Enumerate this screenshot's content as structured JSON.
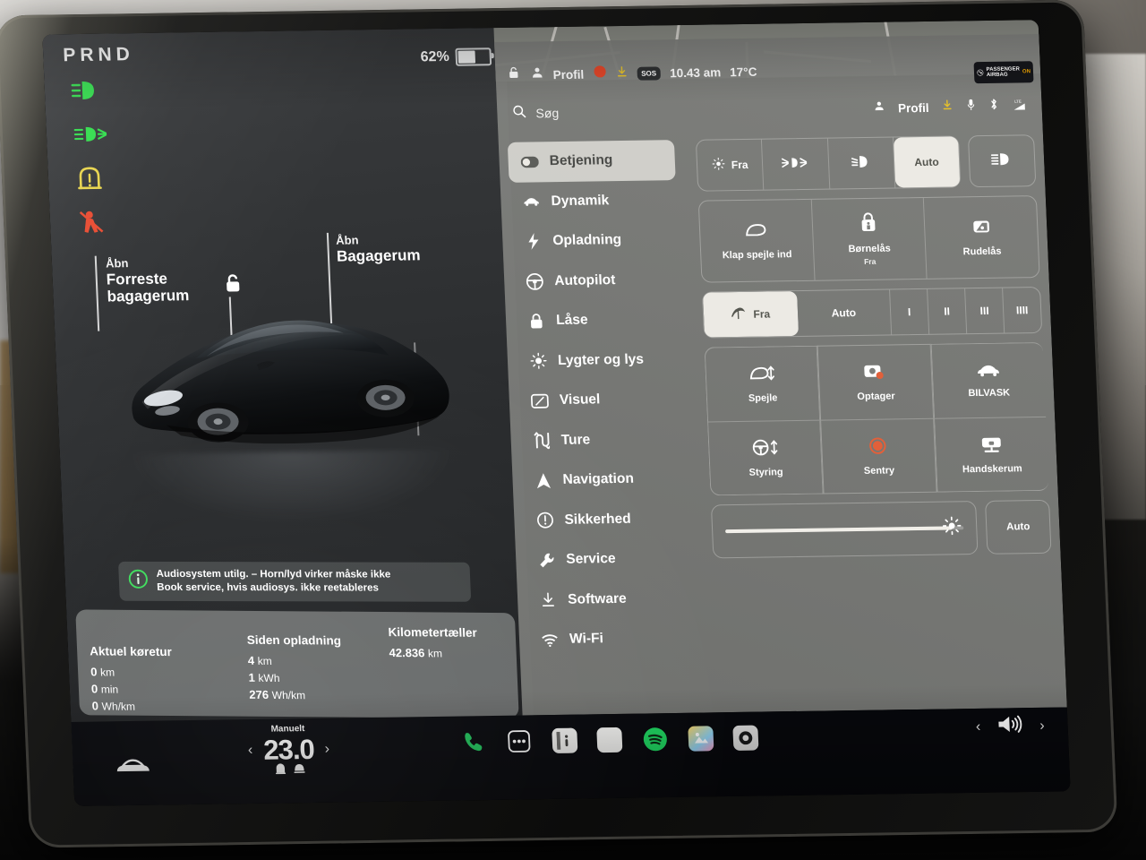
{
  "instrument": {
    "gear": "PRND",
    "battery_percent_label": "62%",
    "battery_percent_value": 62,
    "telltales": [
      {
        "name": "low-beam-telltale",
        "color": "#2fdc4a"
      },
      {
        "name": "front-fog-telltale",
        "color": "#2fdc4a"
      },
      {
        "name": "tire-pressure-telltale",
        "color": "#e8d44a"
      },
      {
        "name": "seatbelt-telltale",
        "color": "#e8492f"
      }
    ],
    "callouts": {
      "frunk": {
        "action": "Åbn",
        "target_line1": "Forreste",
        "target_line2": "bagagerum"
      },
      "trunk": {
        "action": "Åbn",
        "target": "Bagagerum"
      }
    },
    "alert": {
      "line1": "Audiosystem utilg. – Horn/lyd virker måske ikke",
      "line2": "Book service, hvis audiosys. ikke reetableres",
      "icon": "info-icon",
      "icon_color": "#3ddc5b"
    },
    "trip": {
      "columns": [
        {
          "header": "Aktuel køretur",
          "rows": [
            {
              "value": "0",
              "unit": "km"
            },
            {
              "value": "0",
              "unit": "min"
            },
            {
              "value": "0",
              "unit": "Wh/km"
            }
          ]
        },
        {
          "header": "Siden opladning",
          "rows": [
            {
              "value": "4",
              "unit": "km"
            },
            {
              "value": "1",
              "unit": "kWh"
            },
            {
              "value": "276",
              "unit": "Wh/km"
            }
          ]
        },
        {
          "header": "Kilometertæller",
          "rows": [
            {
              "value": "42.836",
              "unit": "km"
            }
          ]
        }
      ],
      "page_dots": 3,
      "active_dot": 1
    }
  },
  "statusbar": {
    "lock_icon": "unlock-icon",
    "profile_label": "Profil",
    "recording_dot_color": "#e2472a",
    "download_icon": "download-icon",
    "sos_label": "SOS",
    "time": "10.43 am",
    "temperature": "17°C",
    "airbag": {
      "line1": "PASSENGER",
      "line2": "AIRBAG",
      "state": "ON"
    }
  },
  "search": {
    "placeholder": "Søg",
    "right_items": [
      {
        "name": "profile-icon",
        "label": "Profil"
      },
      {
        "name": "download-icon",
        "label": ""
      },
      {
        "name": "microphone-icon",
        "label": ""
      },
      {
        "name": "bluetooth-icon",
        "label": ""
      },
      {
        "name": "lte-signal-icon",
        "label": ""
      }
    ]
  },
  "sidebar": {
    "items": [
      {
        "label": "Betjening",
        "icon": "toggle-icon",
        "active": true
      },
      {
        "label": "Dynamik",
        "icon": "car-icon",
        "active": false
      },
      {
        "label": "Opladning",
        "icon": "bolt-icon",
        "active": false
      },
      {
        "label": "Autopilot",
        "icon": "steering-wheel-icon",
        "active": false
      },
      {
        "label": "Låse",
        "icon": "lock-icon",
        "active": false
      },
      {
        "label": "Lygter og lys",
        "icon": "sun-icon",
        "active": false
      },
      {
        "label": "Visuel",
        "icon": "display-icon",
        "active": false
      },
      {
        "label": "Ture",
        "icon": "route-icon",
        "active": false
      },
      {
        "label": "Navigation",
        "icon": "navigation-arrow-icon",
        "active": false
      },
      {
        "label": "Sikkerhed",
        "icon": "exclamation-circle-icon",
        "active": false
      },
      {
        "label": "Service",
        "icon": "wrench-icon",
        "active": false
      },
      {
        "label": "Software",
        "icon": "download-icon",
        "active": false
      },
      {
        "label": "Wi-Fi",
        "icon": "wifi-icon",
        "active": false
      }
    ]
  },
  "controls": {
    "lights": {
      "segments": [
        {
          "label": "Fra",
          "icon": "sun-icon",
          "selected": false
        },
        {
          "label": "",
          "icon": "fog-light-icon",
          "selected": false
        },
        {
          "label": "",
          "icon": "low-beam-icon",
          "selected": false
        },
        {
          "label": "Auto",
          "icon": "",
          "selected": true
        }
      ],
      "high_beam": {
        "icon": "high-beam-icon",
        "selected": false
      }
    },
    "tiles": [
      {
        "label": "Klap spejle ind",
        "sub": "",
        "icon": "mirror-icon"
      },
      {
        "label": "Børnelås",
        "sub": "Fra",
        "icon": "child-lock-icon"
      },
      {
        "label": "Rudelås",
        "sub": "",
        "icon": "window-lock-icon"
      }
    ],
    "wipers": [
      {
        "label": "Fra",
        "icon": "wiper-icon",
        "selected": true
      },
      {
        "label": "Auto",
        "icon": "",
        "selected": false
      },
      {
        "label": "I",
        "icon": "",
        "selected": false
      },
      {
        "label": "II",
        "icon": "",
        "selected": false
      },
      {
        "label": "III",
        "icon": "",
        "selected": false
      },
      {
        "label": "IIII",
        "icon": "",
        "selected": false
      }
    ],
    "grid": [
      [
        {
          "label": "Spejle",
          "icon": "mirror-adjust-icon"
        },
        {
          "label": "Styring",
          "icon": "steering-adjust-icon"
        }
      ],
      [
        {
          "label": "Optager",
          "icon": "dashcam-icon"
        },
        {
          "label": "Sentry",
          "icon": "sentry-icon"
        }
      ],
      [
        {
          "label": "BILVASK",
          "icon": "car-wash-icon"
        },
        {
          "label": "Handskerum",
          "icon": "glovebox-icon"
        }
      ]
    ],
    "brightness": {
      "value": 95,
      "icon": "brightness-icon",
      "auto_label": "Auto"
    }
  },
  "dock": {
    "climate": {
      "mode": "Manuelt",
      "temperature": "23.0",
      "prev_icon": "chevron-left-icon",
      "next_icon": "chevron-right-icon",
      "sub_icons": [
        "seat-heater-icon",
        "defrost-icon"
      ]
    },
    "car_icon": "car-front-icon",
    "apps": [
      {
        "name": "phone-app",
        "icon": "phone-icon",
        "color": "#22c55e"
      },
      {
        "name": "more-apps",
        "icon": "ellipsis-icon",
        "color": "#ffffff"
      },
      {
        "name": "manual-app",
        "icon": "info-book-icon",
        "color": "#f2f2f0"
      },
      {
        "name": "blank-app",
        "icon": "app-icon",
        "color": "#f5f5f3"
      },
      {
        "name": "spotify-app",
        "icon": "spotify-icon",
        "color": "#1ed760"
      },
      {
        "name": "gallery-app",
        "icon": "photos-icon",
        "color": "#f2c14e"
      },
      {
        "name": "camera-app",
        "icon": "camera-icon",
        "color": "#dddddd"
      }
    ],
    "volume": {
      "prev_icon": "chevron-left-icon",
      "icon": "speaker-icon",
      "next_icon": "chevron-right-icon"
    }
  },
  "colors": {
    "panel_bg": "#7e7f7c",
    "selected": "#eceae4",
    "accent_green": "#2fdc4a",
    "accent_red": "#e2472a",
    "accent_yellow": "#e8d44a"
  }
}
